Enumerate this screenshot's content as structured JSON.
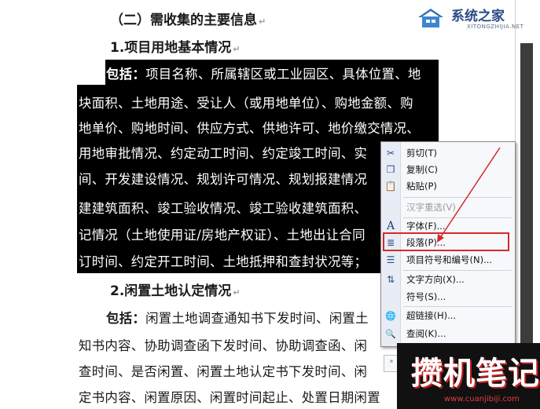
{
  "document": {
    "heading2": "（二）需收集的主要信息",
    "heading3_1": "1.项目用地基本情况",
    "selected_lines": [
      {
        "bold": "包括：",
        "text": "项目名称、所属辖区或工业园区、具体位置、地"
      },
      {
        "bold": "",
        "text": "块面积、土地用途、受让人（或用地单位）、购地金额、购"
      },
      {
        "bold": "",
        "text": "地单价、购地时间、供应方式、供地许可、地价缴交情况、"
      },
      {
        "bold": "",
        "text": "用地审批情况、约定动工时间、约定竣工时间、实"
      },
      {
        "bold": "",
        "text": "间、开发建设情况、规划许可情况、规划报建情况"
      },
      {
        "bold": "",
        "text": "建建筑面积、竣工验收情况、竣工验收建筑面积、"
      },
      {
        "bold": "",
        "text": "记情况（土地使用证/房地产权证）、土地出让合同"
      },
      {
        "bold": "",
        "text": "订时间、约定开工时间、土地抵押和查封状况等；"
      }
    ],
    "heading3_2": "2.闲置土地认定情况",
    "body_lines": [
      {
        "bold": "包括：",
        "text": "闲置土地调查通知书下发时间、闲置土"
      },
      {
        "bold": "",
        "text": "知书内容、协助调查函下发时间、协助调查函、闲"
      },
      {
        "bold": "",
        "text": "查时间、是否闲置、闲置土地认定书下发时间、闲"
      },
      {
        "bold": "",
        "text": "定书内容、闲置原因、闲置时间起止、处置日期闲置"
      }
    ],
    "para_mark": "↵"
  },
  "context_menu": {
    "items": [
      {
        "label": "剪切(T)",
        "icon": "scissors-icon",
        "glyph": "✂",
        "disabled": false
      },
      {
        "label": "复制(C)",
        "icon": "copy-icon",
        "glyph": "❐",
        "disabled": false
      },
      {
        "label": "粘贴(P)",
        "icon": "paste-icon",
        "glyph": "📋",
        "disabled": false
      },
      {
        "label": "汉字重选(V)",
        "icon": "",
        "glyph": "",
        "disabled": true
      },
      {
        "label": "字体(F)...",
        "icon": "font-icon",
        "glyph": "A",
        "disabled": false
      },
      {
        "label": "段落(P)...",
        "icon": "paragraph-icon",
        "glyph": "≣",
        "disabled": false
      },
      {
        "label": "项目符号和编号(N)...",
        "icon": "bullets-icon",
        "glyph": "☰",
        "disabled": false
      },
      {
        "label": "文字方向(X)...",
        "icon": "text-direction-icon",
        "glyph": "⇅",
        "disabled": false
      },
      {
        "label": "符号(S)...",
        "icon": "",
        "glyph": "",
        "disabled": false
      },
      {
        "label": "超链接(H)...",
        "icon": "hyperlink-icon",
        "glyph": "🌐",
        "disabled": false
      },
      {
        "label": "查阅(K)...",
        "icon": "lookup-icon",
        "glyph": "🔍",
        "disabled": false
      },
      {
        "label": "",
        "icon": "translate-icon",
        "glyph": "ᵃ",
        "disabled": false
      }
    ],
    "highlighted_item": "段落(P)...",
    "highlight_color": "#d42a2a"
  },
  "watermark_top": {
    "title": "系统之家",
    "url": "XITONGZHIJIA.NET"
  },
  "watermark_bottom": {
    "title": "攒机笔记",
    "url": "www.cuanjibiji.com"
  }
}
